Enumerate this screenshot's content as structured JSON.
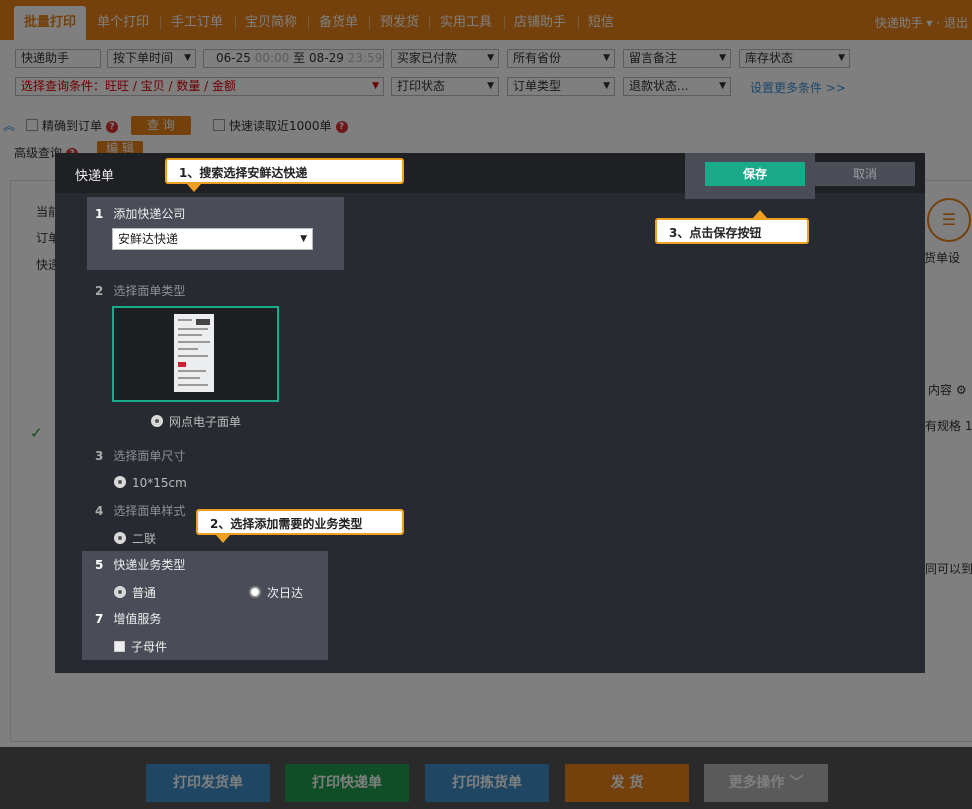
{
  "nav": {
    "tabs": [
      "批量打印",
      "单个打印",
      "手工订单",
      "宝贝简称",
      "备货单",
      "预发货",
      "实用工具",
      "店铺助手",
      "短信"
    ],
    "right": "快递助手 ▾ · 退出"
  },
  "filters": {
    "row1": {
      "helper": "快递助手",
      "order_time": "按下单时间",
      "date_start": "06-25",
      "time_start": "00:00",
      "to": "至",
      "date_end": "08-29",
      "time_end": "23:59",
      "pay_status": "买家已付款",
      "province": "所有省份",
      "remark": "留言备注",
      "stock": "库存状态"
    },
    "row2": {
      "query": "选择查询条件：旺旺 / 宝贝 / 数量 / 金额",
      "print_status": "打印状态",
      "order_type": "订单类型",
      "refund": "退款状态...",
      "more_link": "设置更多条件 >>"
    },
    "row3": {
      "exact": "精确到订单",
      "query_btn": "查 询",
      "fast_read": "快速读取近1000单"
    },
    "row4": {
      "advanced": "高级查询",
      "edit_btn": "编 辑"
    }
  },
  "background": {
    "left": [
      "当前",
      "订单",
      "快递"
    ],
    "right_icon_label": "货单设",
    "column_content": "内容",
    "spec": "有规格 1",
    "hint": "同可以到"
  },
  "bottom": {
    "print_ship": "打印发货单",
    "print_express": "打印快递单",
    "print_pick": "打印拣货单",
    "ship": "发 货",
    "more": "更多操作"
  },
  "modal": {
    "title": "快递单",
    "save": "保存",
    "cancel": "取消",
    "steps": [
      {
        "num": "1",
        "label": "添加快递公司"
      },
      {
        "num": "2",
        "label": "选择面单类型"
      },
      {
        "num": "3",
        "label": "选择面单尺寸"
      },
      {
        "num": "4",
        "label": "选择面单样式"
      },
      {
        "num": "5",
        "label": "快递业务类型"
      },
      {
        "num": "7",
        "label": "增值服务"
      }
    ],
    "company_select": "安鲜达快递",
    "sheet_type_option": "网点电子面单",
    "size_option": "10*15cm",
    "style_option": "二联",
    "biz_options": [
      "普通",
      "次日达"
    ],
    "value_added": "子母件"
  },
  "callouts": {
    "c1": "1、搜索选择安鲜达快递",
    "c2": "2、选择添加需要的业务类型",
    "c3": "3、点击保存按钮"
  }
}
